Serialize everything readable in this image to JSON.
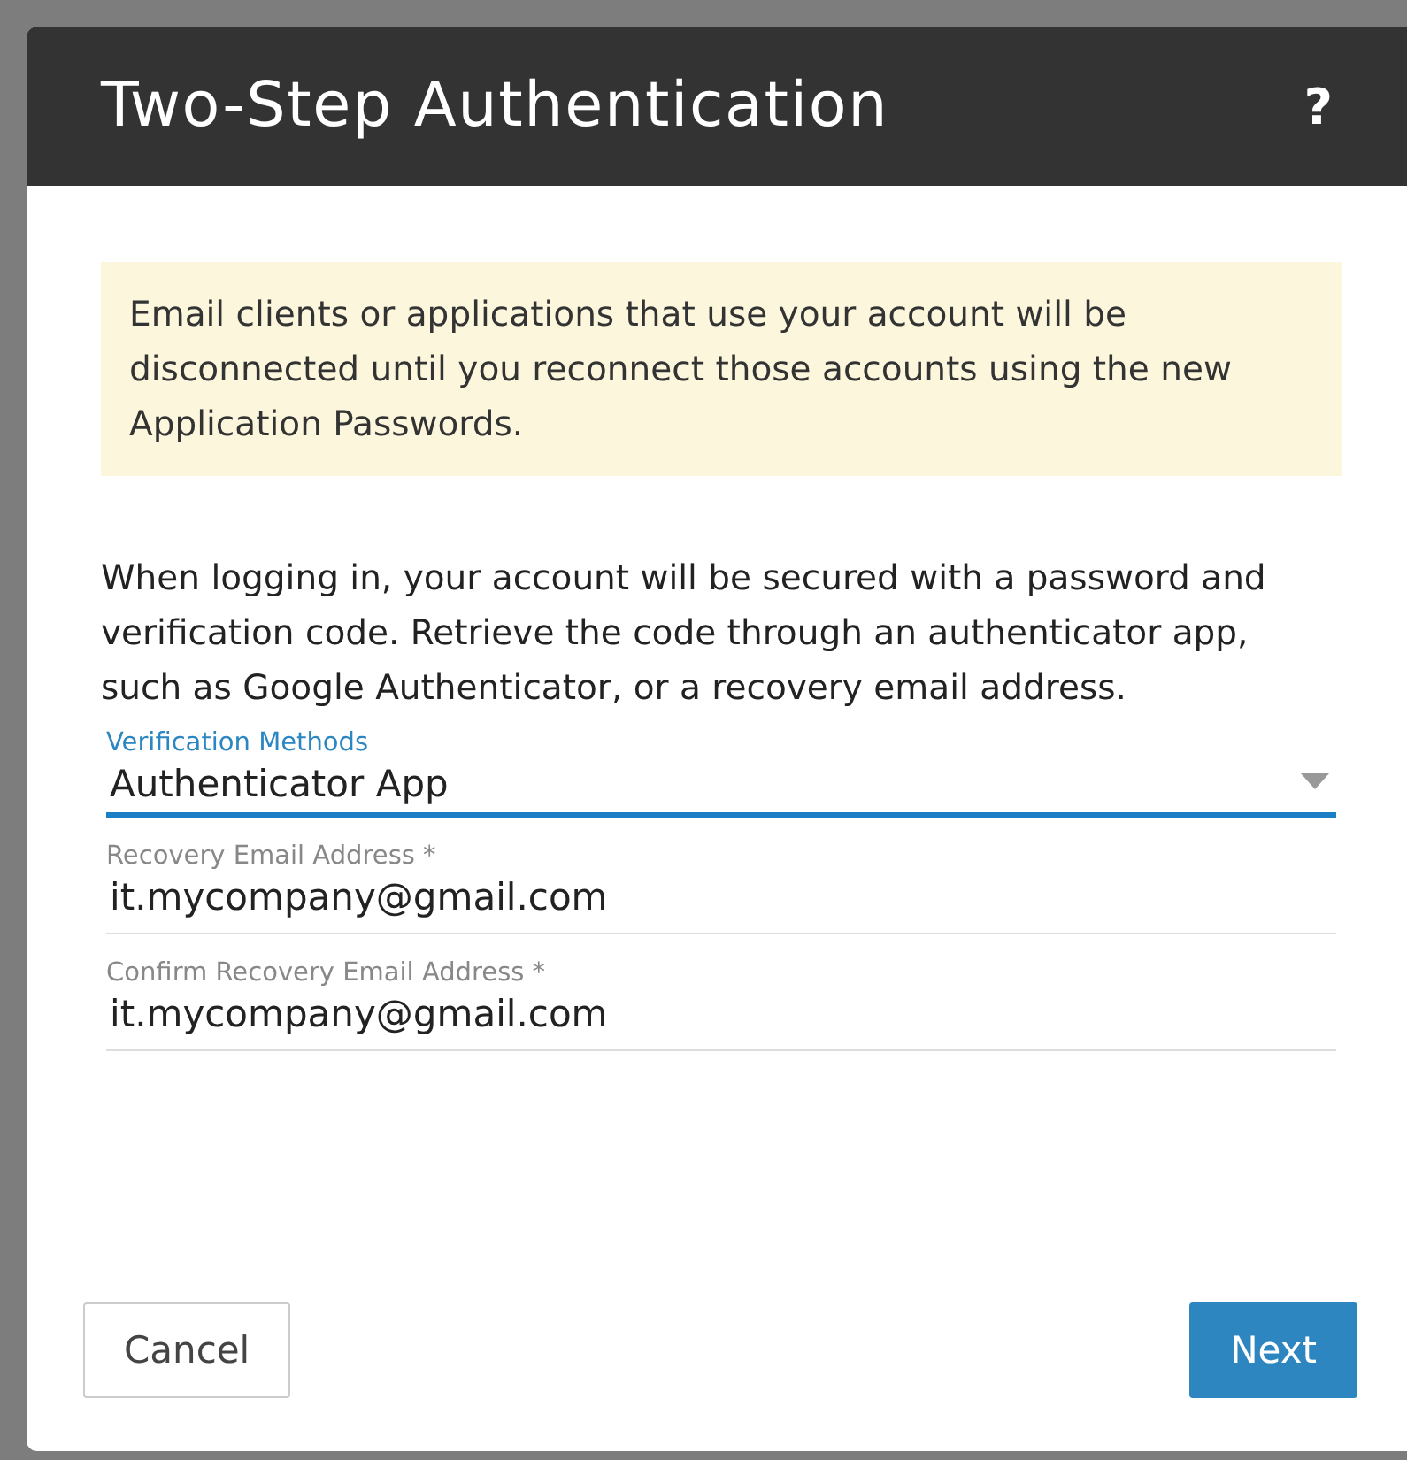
{
  "dialog": {
    "title": "Two-Step Authentication",
    "help": "?"
  },
  "notice": "Email clients or applications that use your account will be disconnected until you reconnect those accounts using the new Application Passwords.",
  "description": "When logging in, your account will be secured with a password and verification code. Retrieve the code through an authenticator app, such as Google Authenticator, or a recovery email address.",
  "fields": [
    {
      "kind": "select",
      "label": "Verification Methods",
      "value": "Authenticator App",
      "focused": true
    },
    {
      "kind": "text",
      "label": "Recovery Email Address *",
      "value": "it.mycompany@gmail.com",
      "focused": false
    },
    {
      "kind": "text",
      "label": "Confirm Recovery Email Address *",
      "value": "it.mycompany@gmail.com",
      "focused": false
    }
  ],
  "buttons": [
    {
      "label": "Cancel",
      "primary": false
    },
    {
      "label": "Next",
      "primary": true
    }
  ]
}
